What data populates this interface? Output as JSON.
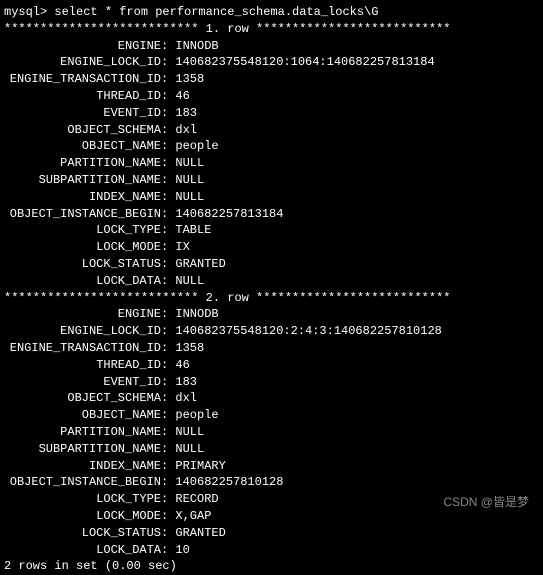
{
  "prompt": "mysql> select * from performance_schema.data_locks\\G",
  "row_header_prefix": "*************************** ",
  "row_header_suffix": ". row ***************************",
  "rows": [
    {
      "index": "1",
      "fields": [
        {
          "label": "ENGINE",
          "value": "INNODB"
        },
        {
          "label": "ENGINE_LOCK_ID",
          "value": "140682375548120:1064:140682257813184"
        },
        {
          "label": "ENGINE_TRANSACTION_ID",
          "value": "1358"
        },
        {
          "label": "THREAD_ID",
          "value": "46"
        },
        {
          "label": "EVENT_ID",
          "value": "183"
        },
        {
          "label": "OBJECT_SCHEMA",
          "value": "dxl"
        },
        {
          "label": "OBJECT_NAME",
          "value": "people"
        },
        {
          "label": "PARTITION_NAME",
          "value": "NULL"
        },
        {
          "label": "SUBPARTITION_NAME",
          "value": "NULL"
        },
        {
          "label": "INDEX_NAME",
          "value": "NULL"
        },
        {
          "label": "OBJECT_INSTANCE_BEGIN",
          "value": "140682257813184"
        },
        {
          "label": "LOCK_TYPE",
          "value": "TABLE"
        },
        {
          "label": "LOCK_MODE",
          "value": "IX"
        },
        {
          "label": "LOCK_STATUS",
          "value": "GRANTED"
        },
        {
          "label": "LOCK_DATA",
          "value": "NULL"
        }
      ]
    },
    {
      "index": "2",
      "fields": [
        {
          "label": "ENGINE",
          "value": "INNODB"
        },
        {
          "label": "ENGINE_LOCK_ID",
          "value": "140682375548120:2:4:3:140682257810128"
        },
        {
          "label": "ENGINE_TRANSACTION_ID",
          "value": "1358"
        },
        {
          "label": "THREAD_ID",
          "value": "46"
        },
        {
          "label": "EVENT_ID",
          "value": "183"
        },
        {
          "label": "OBJECT_SCHEMA",
          "value": "dxl"
        },
        {
          "label": "OBJECT_NAME",
          "value": "people"
        },
        {
          "label": "PARTITION_NAME",
          "value": "NULL"
        },
        {
          "label": "SUBPARTITION_NAME",
          "value": "NULL"
        },
        {
          "label": "INDEX_NAME",
          "value": "PRIMARY"
        },
        {
          "label": "OBJECT_INSTANCE_BEGIN",
          "value": "140682257810128"
        },
        {
          "label": "LOCK_TYPE",
          "value": "RECORD"
        },
        {
          "label": "LOCK_MODE",
          "value": "X,GAP"
        },
        {
          "label": "LOCK_STATUS",
          "value": "GRANTED"
        },
        {
          "label": "LOCK_DATA",
          "value": "10"
        }
      ]
    }
  ],
  "footer": "2 rows in set (0.00 sec)",
  "watermark": "CSDN @皆是梦"
}
